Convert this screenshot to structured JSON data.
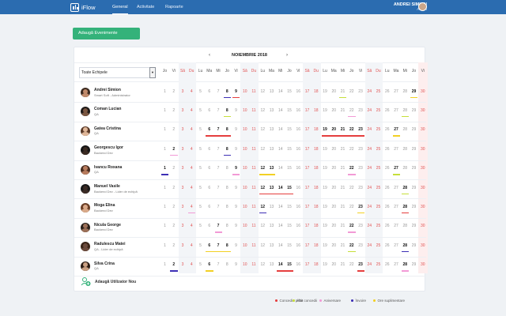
{
  "header": {
    "logo_text": "iFlow",
    "nav": [
      "General",
      "Activitate",
      "Rapoarte"
    ],
    "active_tab": "General",
    "user_name": "ANDREI SIMION",
    "user_role": "Admin"
  },
  "actions": {
    "add_events": "Adaugă Evenimente"
  },
  "calendar": {
    "month_label": "NOIEMBRIE 2018",
    "prev_icon": "chevron-left-icon",
    "next_icon": "chevron-right-icon",
    "team_filter": "Toate Echipele",
    "weekday_headers": [
      "Jo",
      "Vi",
      "Sâ",
      "Du",
      "Lu",
      "Ma",
      "Mi",
      "Jo",
      "Vi",
      "Sâ",
      "Du",
      "Lu",
      "Ma",
      "Mi",
      "Jo",
      "Vi",
      "Sâ",
      "Du",
      "Lu",
      "Ma",
      "Mi",
      "Jo",
      "Vi",
      "Sâ",
      "Du",
      "Lu",
      "Ma",
      "Mi",
      "Jo",
      "Vi"
    ],
    "weekend_days": [
      3,
      4,
      10,
      11,
      17,
      18,
      24,
      25
    ],
    "today": 30,
    "add_user_label": "Adaugă Utilizator Nou"
  },
  "employees": [
    {
      "name": "Andrei Simion",
      "role": "Smart Soft - Administrator",
      "bold_days": [
        8,
        9,
        29
      ],
      "events": [
        {
          "from": 8,
          "to": 8,
          "type": "extra"
        },
        {
          "from": 9,
          "to": 9,
          "type": "paid"
        },
        {
          "from": 21,
          "to": 21,
          "type": "other"
        },
        {
          "from": 29,
          "to": 29,
          "type": "overtime"
        }
      ]
    },
    {
      "name": "Coman Lucian",
      "role": "QA",
      "bold_days": [
        8
      ],
      "events": [
        {
          "from": 8,
          "to": 8,
          "type": "other"
        },
        {
          "from": 22,
          "to": 22,
          "type": "birthday"
        },
        {
          "from": 28,
          "to": 28,
          "type": "other"
        }
      ]
    },
    {
      "name": "Gatea Cristina",
      "role": "QA",
      "bold_days": [
        6,
        7,
        8,
        19,
        20,
        21,
        22,
        23,
        27
      ],
      "events": [
        {
          "from": 6,
          "to": 8,
          "type": "paid"
        },
        {
          "from": 19,
          "to": 23,
          "type": "paid"
        },
        {
          "from": 27,
          "to": 27,
          "type": "overtime"
        }
      ]
    },
    {
      "name": "Georgescu Igor",
      "role": "Backend Dev",
      "bold_days": [
        2,
        8
      ],
      "events": [
        {
          "from": 2,
          "to": 2,
          "type": "birthday"
        },
        {
          "from": 8,
          "to": 8,
          "type": "extra"
        }
      ]
    },
    {
      "name": "Ivancu Roxana",
      "role": "QA",
      "bold_days": [
        1,
        9,
        12,
        13,
        22,
        27
      ],
      "events": [
        {
          "from": 1,
          "to": 1,
          "type": "extra"
        },
        {
          "from": 9,
          "to": 9,
          "type": "birthday"
        },
        {
          "from": 12,
          "to": 13,
          "type": "overtime"
        },
        {
          "from": 22,
          "to": 22,
          "type": "birthday"
        },
        {
          "from": 27,
          "to": 27,
          "type": "other"
        }
      ]
    },
    {
      "name": "Manuel Vasile",
      "role": "Backend Dev - Lider de echipă",
      "bold_days": [
        12,
        13,
        14,
        15,
        28
      ],
      "events": [
        {
          "from": 12,
          "to": 15,
          "type": "paid"
        },
        {
          "from": 28,
          "to": 28,
          "type": "other"
        }
      ]
    },
    {
      "name": "Moga Elina",
      "role": "Backend Dev",
      "bold_days": [
        12,
        23,
        28
      ],
      "events": [
        {
          "from": 4,
          "to": 4,
          "type": "birthday"
        },
        {
          "from": 12,
          "to": 12,
          "type": "extra"
        },
        {
          "from": 23,
          "to": 23,
          "type": "overtime"
        },
        {
          "from": 28,
          "to": 28,
          "type": "paid"
        }
      ]
    },
    {
      "name": "Nicula George",
      "role": "Backend Dev",
      "bold_days": [
        7,
        22
      ],
      "events": [
        {
          "from": 7,
          "to": 7,
          "type": "birthday"
        },
        {
          "from": 22,
          "to": 22,
          "type": "birthday"
        }
      ]
    },
    {
      "name": "Radulescu Matei",
      "role": "QA - Lider de echipă",
      "bold_days": [
        6,
        7,
        8,
        22,
        28
      ],
      "events": [
        {
          "from": 6,
          "to": 8,
          "type": "overtime"
        },
        {
          "from": 22,
          "to": 22,
          "type": "other"
        },
        {
          "from": 28,
          "to": 28,
          "type": "extra"
        }
      ]
    },
    {
      "name": "Silva Crina",
      "role": "QA",
      "bold_days": [
        2,
        6,
        14,
        15,
        23,
        28
      ],
      "events": [
        {
          "from": 2,
          "to": 2,
          "type": "extra"
        },
        {
          "from": 6,
          "to": 6,
          "type": "overtime"
        },
        {
          "from": 14,
          "to": 15,
          "type": "paid"
        },
        {
          "from": 23,
          "to": 23,
          "type": "paid"
        },
        {
          "from": 28,
          "to": 28,
          "type": "birthday"
        }
      ]
    }
  ],
  "legend": [
    {
      "key": "paid",
      "label": "Concediu plătit",
      "color": "#e53e3e"
    },
    {
      "key": "other",
      "label": "Alte concedii",
      "color": "#c6df3a"
    },
    {
      "key": "birthday",
      "label": "Aniversare",
      "color": "#f29ad6"
    },
    {
      "key": "extra",
      "label": "Învoire",
      "color": "#3d2fb5"
    },
    {
      "key": "overtime",
      "label": "Ore suplimentare",
      "color": "#f2d024"
    }
  ]
}
